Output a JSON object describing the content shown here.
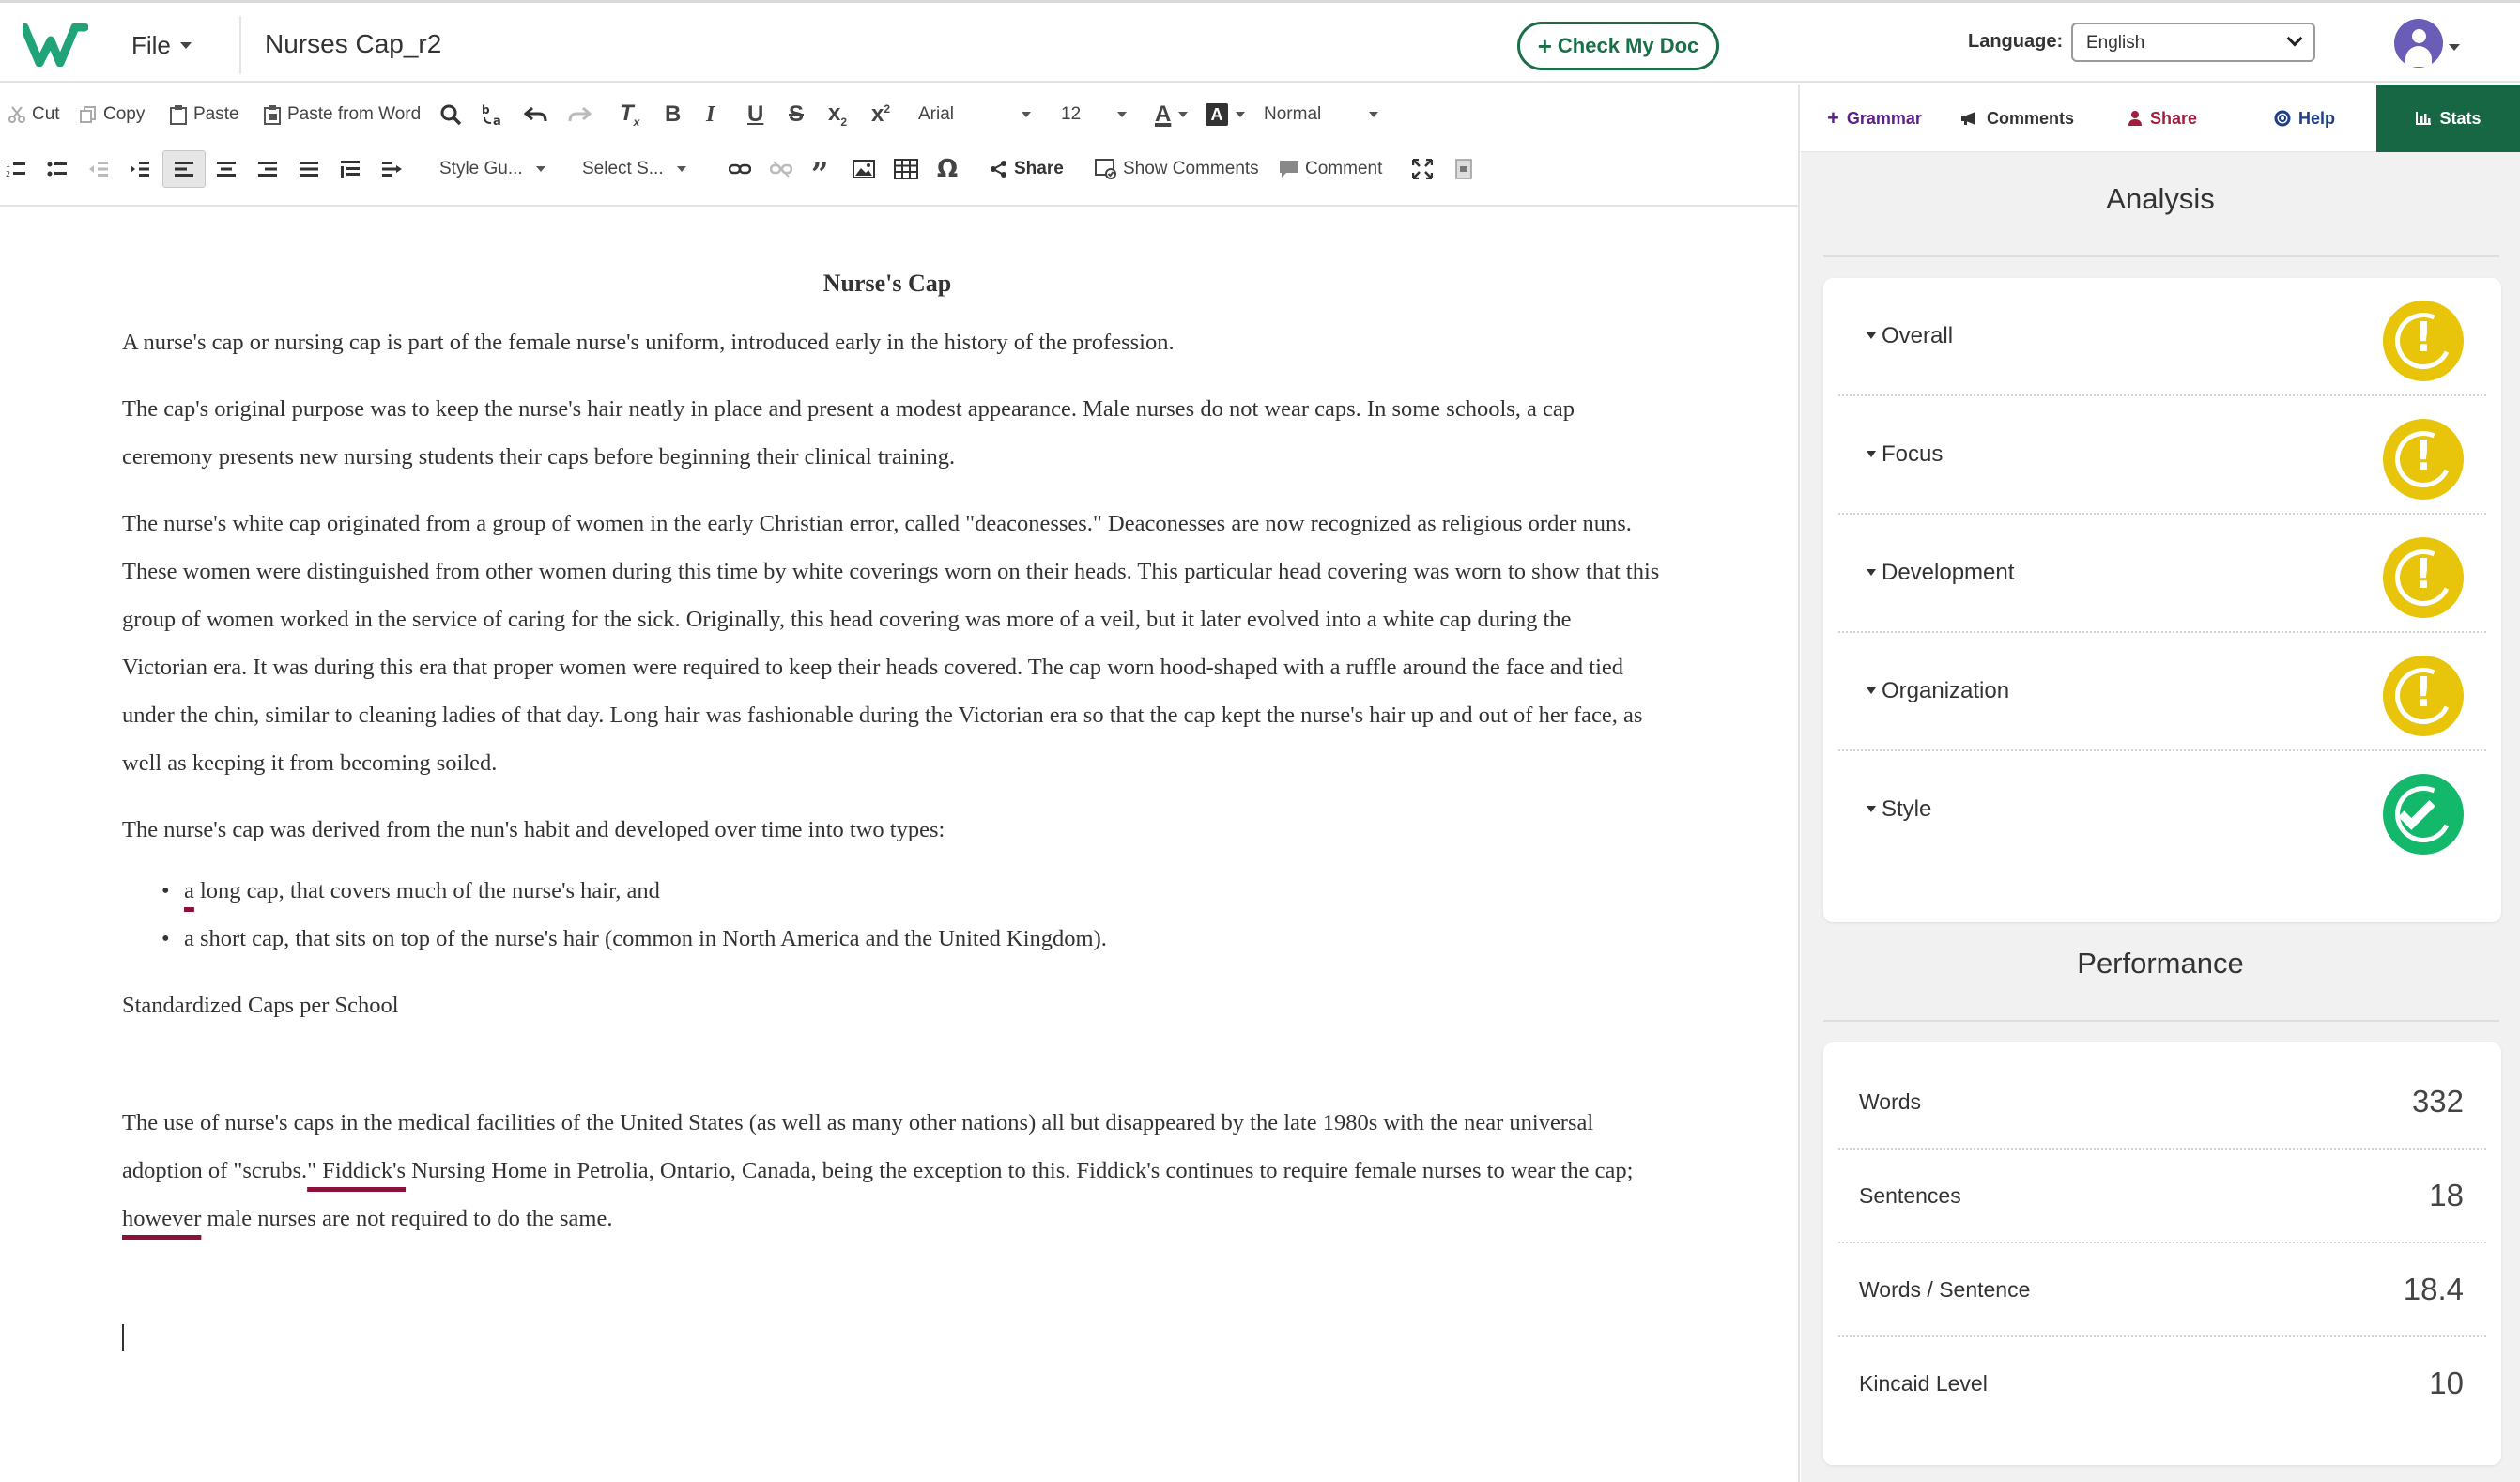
{
  "topbar": {
    "file_label": "File",
    "doc_title": "Nurses Cap_r2",
    "check_button": "Check My Doc",
    "language_label": "Language:",
    "language_value": "English"
  },
  "toolbar": {
    "cut": "Cut",
    "copy": "Copy",
    "paste": "Paste",
    "paste_from_word": "Paste from Word",
    "font_family": "Arial",
    "font_size": "12",
    "format": "Normal",
    "style_guide": "Style Gu...",
    "select_s": "Select S...",
    "share": "Share",
    "show_comments": "Show Comments",
    "comment": "Comment"
  },
  "document": {
    "heading": "Nurse's Cap",
    "p1": "A nurse's cap or nursing cap is part of the female nurse's uniform, introduced early in the history of the profession.",
    "p2": "The cap's original purpose was to keep the nurse's hair neatly in place and present a modest appearance. Male nurses do not wear caps. In some schools, a cap ceremony presents new nursing students their caps before beginning their clinical training.",
    "p3": "The nurse's white cap originated from a group of women in the early Christian error,  called \"deaconesses.\" Deaconesses are now recognized as religious order nuns. These women were distinguished from other women during this time by white coverings worn on their heads. This particular head covering was worn to show that this group of women worked in the service of caring for the sick. Originally, this head covering was more of a veil, but it later evolved into a white cap during the Victorian era. It was during this era that proper women were required to keep their heads covered. The cap worn hood-shaped with a ruffle around the face and tied under the chin, similar to cleaning ladies of that day. Long hair was fashionable during the Victorian era so that the cap kept the nurse's hair up and out of her face, as well as keeping it from becoming soiled.",
    "p4": "The nurse's cap was derived from the nun's habit and developed over time into two types:",
    "bullet1_flag": "a",
    "bullet1_rest": " long cap, that covers much of the nurse's hair, and",
    "bullet2": "a short cap, that sits on top of the nurse's hair (common in North America and the United Kingdom).",
    "p5": "Standardized Caps per School",
    "p6_a": "The use of nurse's caps in the medical facilities of the United States (as well as many other nations) all but disappeared by the late 1980s with the near universal adoption of \"scrubs.",
    "p6_flag1": "\" Fiddick's",
    "p6_b": " Nursing Home in Petrolia, Ontario, Canada, being the exception to this. Fiddick's continues to require female nurses to wear the cap; ",
    "p6_flag2": "however",
    "p6_c": " male nurses are not required to do the same."
  },
  "panel": {
    "tabs": {
      "grammar": "Grammar",
      "comments": "Comments",
      "share": "Share",
      "help": "Help",
      "stats": "Stats"
    },
    "analysis_title": "Analysis",
    "analysis": [
      {
        "label": "Overall",
        "status": "warning"
      },
      {
        "label": "Focus",
        "status": "warning"
      },
      {
        "label": "Development",
        "status": "warning"
      },
      {
        "label": "Organization",
        "status": "warning"
      },
      {
        "label": "Style",
        "status": "ok"
      }
    ],
    "performance_title": "Performance",
    "performance": [
      {
        "label": "Words",
        "value": "332"
      },
      {
        "label": "Sentences",
        "value": "18"
      },
      {
        "label": "Words / Sentence",
        "value": "18.4"
      },
      {
        "label": "Kincaid Level",
        "value": "10"
      }
    ]
  },
  "colors": {
    "brand_green": "#176745",
    "warning_yellow": "#e8c40b",
    "ok_green": "#14b86a",
    "error_underline": "#8a1238",
    "grammar_purple": "#5a1f8a",
    "share_red": "#a21e3e",
    "help_blue": "#1d3e8a"
  }
}
